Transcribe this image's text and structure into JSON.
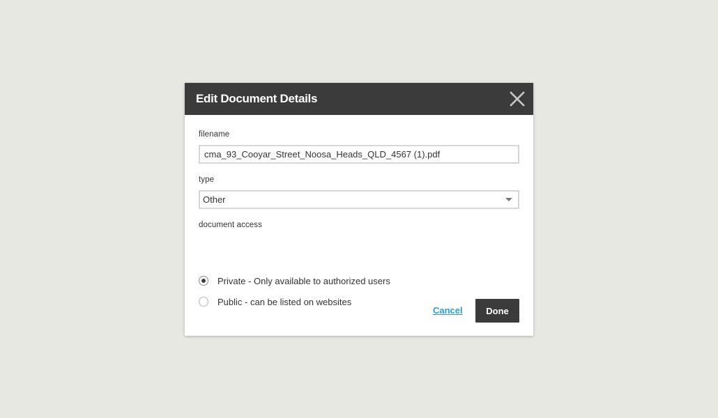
{
  "dialog": {
    "title": "Edit Document Details",
    "close_icon": "close-icon"
  },
  "filename": {
    "label": "filename",
    "value": "cma_93_Cooyar_Street_Noosa_Heads_QLD_4567 (1).pdf"
  },
  "type": {
    "label": "type",
    "selected": "Other"
  },
  "access": {
    "label": "document access",
    "options": [
      {
        "label": "Private - Only available to authorized users",
        "checked": true
      },
      {
        "label": "Public - can be listed on websites",
        "checked": false
      }
    ]
  },
  "actions": {
    "cancel_label": "Cancel",
    "done_label": "Done"
  },
  "colors": {
    "header_bg": "#3b3b3b",
    "link": "#2a9fd6",
    "backdrop": "#e8e8e3"
  }
}
